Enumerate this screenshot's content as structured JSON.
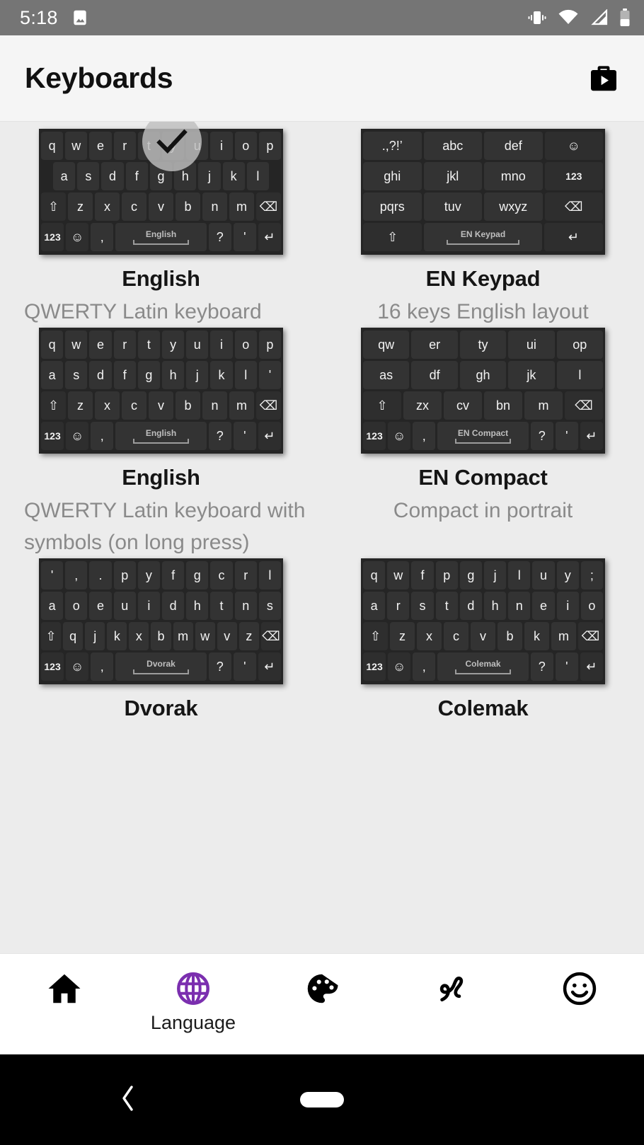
{
  "status_bar": {
    "time": "5:18",
    "left_icons": [
      "image-icon"
    ],
    "right_icons": [
      "vibrate-icon",
      "wifi-icon",
      "cell-signal-icon",
      "battery-icon"
    ],
    "background": "#757575"
  },
  "app_bar": {
    "title": "Keyboards",
    "action_icon": "play-store-icon",
    "background": "#F5F5F5"
  },
  "keyboards": [
    {
      "name": "English",
      "description": "QWERTY Latin keyboard",
      "selected": true,
      "desc_align": "left",
      "rows": [
        [
          {
            "l": "q"
          },
          {
            "l": "w"
          },
          {
            "l": "e"
          },
          {
            "l": "r"
          },
          {
            "l": "t"
          },
          {
            "l": "y"
          },
          {
            "l": "u"
          },
          {
            "l": "i"
          },
          {
            "l": "o"
          },
          {
            "l": "p"
          }
        ],
        [
          {
            "l": "a"
          },
          {
            "l": "s"
          },
          {
            "l": "d"
          },
          {
            "l": "f"
          },
          {
            "l": "g"
          },
          {
            "l": "h"
          },
          {
            "l": "j"
          },
          {
            "l": "k"
          },
          {
            "l": "l"
          }
        ],
        [
          {
            "l": "⇧",
            "mod": true
          },
          {
            "l": "z"
          },
          {
            "l": "x"
          },
          {
            "l": "c"
          },
          {
            "l": "v"
          },
          {
            "l": "b"
          },
          {
            "l": "n"
          },
          {
            "l": "m"
          },
          {
            "l": "⌫",
            "mod": true
          }
        ],
        [
          {
            "l": "123",
            "num": true,
            "mod": true
          },
          {
            "l": "☺",
            "mod": true
          },
          {
            "l": ","
          },
          {
            "l": "English",
            "space": true
          },
          {
            "l": "?"
          },
          {
            "l": "'"
          },
          {
            "l": "↵",
            "mod": true
          }
        ]
      ],
      "row2_indent": true
    },
    {
      "name": "EN Keypad",
      "description": "16 keys English layout",
      "selected": false,
      "desc_align": "center",
      "rows": [
        [
          {
            "l": ".,?!’"
          },
          {
            "l": "abc"
          },
          {
            "l": "def"
          },
          {
            "l": "☺",
            "mod": true
          }
        ],
        [
          {
            "l": "ghi"
          },
          {
            "l": "jkl"
          },
          {
            "l": "mno"
          },
          {
            "l": "123",
            "num": true,
            "mod": true
          }
        ],
        [
          {
            "l": "pqrs"
          },
          {
            "l": "tuv"
          },
          {
            "l": "wxyz"
          },
          {
            "l": "⌫",
            "mod": true
          }
        ],
        [
          {
            "l": "⇧",
            "mod": true
          },
          {
            "l": "EN Keypad",
            "space": true,
            "wide2": true
          },
          {
            "l": "↵",
            "mod": true
          }
        ]
      ]
    },
    {
      "name": "English",
      "description": "QWERTY Latin keyboard with symbols (on long press)",
      "selected": false,
      "desc_align": "left",
      "rows": [
        [
          {
            "l": "q"
          },
          {
            "l": "w"
          },
          {
            "l": "e"
          },
          {
            "l": "r"
          },
          {
            "l": "t"
          },
          {
            "l": "y"
          },
          {
            "l": "u"
          },
          {
            "l": "i"
          },
          {
            "l": "o"
          },
          {
            "l": "p"
          }
        ],
        [
          {
            "l": "a"
          },
          {
            "l": "s"
          },
          {
            "l": "d"
          },
          {
            "l": "f"
          },
          {
            "l": "g"
          },
          {
            "l": "h"
          },
          {
            "l": "j"
          },
          {
            "l": "k"
          },
          {
            "l": "l"
          },
          {
            "l": "'"
          }
        ],
        [
          {
            "l": "⇧",
            "mod": true
          },
          {
            "l": "z"
          },
          {
            "l": "x"
          },
          {
            "l": "c"
          },
          {
            "l": "v"
          },
          {
            "l": "b"
          },
          {
            "l": "n"
          },
          {
            "l": "m"
          },
          {
            "l": "⌫",
            "mod": true
          }
        ],
        [
          {
            "l": "123",
            "num": true,
            "mod": true
          },
          {
            "l": "☺",
            "mod": true
          },
          {
            "l": ","
          },
          {
            "l": "English",
            "space": true
          },
          {
            "l": "?"
          },
          {
            "l": "'"
          },
          {
            "l": "↵",
            "mod": true
          }
        ]
      ]
    },
    {
      "name": "EN Compact",
      "description": "Compact in portrait",
      "selected": false,
      "desc_align": "center",
      "rows": [
        [
          {
            "l": "qw"
          },
          {
            "l": "er"
          },
          {
            "l": "ty"
          },
          {
            "l": "ui"
          },
          {
            "l": "op"
          }
        ],
        [
          {
            "l": "as"
          },
          {
            "l": "df"
          },
          {
            "l": "gh"
          },
          {
            "l": "jk"
          },
          {
            "l": "l"
          }
        ],
        [
          {
            "l": "⇧",
            "mod": true
          },
          {
            "l": "zx"
          },
          {
            "l": "cv"
          },
          {
            "l": "bn"
          },
          {
            "l": "m"
          },
          {
            "l": "⌫",
            "mod": true
          }
        ],
        [
          {
            "l": "123",
            "num": true,
            "mod": true
          },
          {
            "l": "☺",
            "mod": true
          },
          {
            "l": ","
          },
          {
            "l": "EN Compact",
            "space": true
          },
          {
            "l": "?"
          },
          {
            "l": "'"
          },
          {
            "l": "↵",
            "mod": true
          }
        ]
      ]
    },
    {
      "name": "Dvorak",
      "description": "",
      "selected": false,
      "desc_align": "center",
      "rows": [
        [
          {
            "l": "'"
          },
          {
            "l": ","
          },
          {
            "l": "."
          },
          {
            "l": "p"
          },
          {
            "l": "y"
          },
          {
            "l": "f"
          },
          {
            "l": "g"
          },
          {
            "l": "c"
          },
          {
            "l": "r"
          },
          {
            "l": "l"
          }
        ],
        [
          {
            "l": "a"
          },
          {
            "l": "o"
          },
          {
            "l": "e"
          },
          {
            "l": "u"
          },
          {
            "l": "i"
          },
          {
            "l": "d"
          },
          {
            "l": "h"
          },
          {
            "l": "t"
          },
          {
            "l": "n"
          },
          {
            "l": "s"
          }
        ],
        [
          {
            "l": "⇧",
            "mod": true
          },
          {
            "l": "q"
          },
          {
            "l": "j"
          },
          {
            "l": "k"
          },
          {
            "l": "x"
          },
          {
            "l": "b"
          },
          {
            "l": "m"
          },
          {
            "l": "w"
          },
          {
            "l": "v"
          },
          {
            "l": "z"
          },
          {
            "l": "⌫",
            "mod": true
          }
        ],
        [
          {
            "l": "123",
            "num": true,
            "mod": true
          },
          {
            "l": "☺",
            "mod": true
          },
          {
            "l": ","
          },
          {
            "l": "Dvorak",
            "space": true
          },
          {
            "l": "?"
          },
          {
            "l": "'"
          },
          {
            "l": "↵",
            "mod": true
          }
        ]
      ]
    },
    {
      "name": "Colemak",
      "description": "",
      "selected": false,
      "desc_align": "center",
      "rows": [
        [
          {
            "l": "q"
          },
          {
            "l": "w"
          },
          {
            "l": "f"
          },
          {
            "l": "p"
          },
          {
            "l": "g"
          },
          {
            "l": "j"
          },
          {
            "l": "l"
          },
          {
            "l": "u"
          },
          {
            "l": "y"
          },
          {
            "l": ";"
          }
        ],
        [
          {
            "l": "a"
          },
          {
            "l": "r"
          },
          {
            "l": "s"
          },
          {
            "l": "t"
          },
          {
            "l": "d"
          },
          {
            "l": "h"
          },
          {
            "l": "n"
          },
          {
            "l": "e"
          },
          {
            "l": "i"
          },
          {
            "l": "o"
          }
        ],
        [
          {
            "l": "⇧",
            "mod": true
          },
          {
            "l": "z"
          },
          {
            "l": "x"
          },
          {
            "l": "c"
          },
          {
            "l": "v"
          },
          {
            "l": "b"
          },
          {
            "l": "k"
          },
          {
            "l": "m"
          },
          {
            "l": "⌫",
            "mod": true
          }
        ],
        [
          {
            "l": "123",
            "num": true,
            "mod": true
          },
          {
            "l": "☺",
            "mod": true
          },
          {
            "l": ","
          },
          {
            "l": "Colemak",
            "space": true
          },
          {
            "l": "?"
          },
          {
            "l": "'"
          },
          {
            "l": "↵",
            "mod": true
          }
        ]
      ]
    }
  ],
  "bottom_nav": {
    "active_color": "#7B2FAF",
    "items": [
      {
        "icon": "home-icon",
        "label": "",
        "active": false
      },
      {
        "icon": "globe-icon",
        "label": "Language",
        "active": true
      },
      {
        "icon": "palette-icon",
        "label": "",
        "active": false
      },
      {
        "icon": "gesture-icon",
        "label": "",
        "active": false
      },
      {
        "icon": "emoji-icon",
        "label": "",
        "active": false
      }
    ]
  },
  "system_nav": {
    "back_icon": "back-chevron-icon",
    "home_icon": "home-pill-icon",
    "background": "#000000"
  }
}
